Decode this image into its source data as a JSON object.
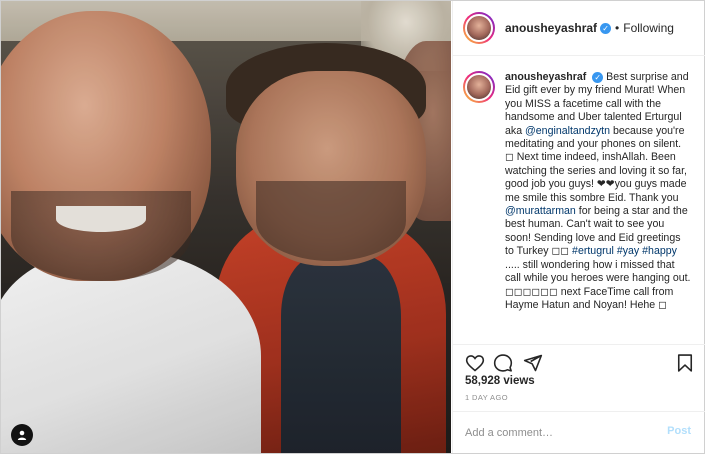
{
  "post": {
    "username": "anousheyashraf",
    "separator": "•",
    "follow_status": "Following"
  },
  "caption": {
    "username": "anousheyashraf",
    "segments": [
      {
        "text": "Best surprise and Eid gift ever by my friend Murat! When you MISS a facetime call with the handsome and Uber talented Erturgul aka ",
        "link": false
      },
      {
        "text": "@enginaltandzytn",
        "link": true
      },
      {
        "text": " because you're meditating and your phones on silent. ◻ Next time indeed, inshAllah. Been watching the series and loving it so far, good job you guys! ❤❤you guys made me smile this sombre Eid. Thank you ",
        "link": false
      },
      {
        "text": "@murattarman",
        "link": true
      },
      {
        "text": " for being a star and the best human. Can't wait to see you soon! Sending love and Eid greetings to Turkey ◻◻ ",
        "link": false
      },
      {
        "text": "#ertugrul",
        "link": true
      },
      {
        "text": " ",
        "link": false
      },
      {
        "text": "#yay",
        "link": true
      },
      {
        "text": " ",
        "link": false
      },
      {
        "text": "#happy",
        "link": true
      },
      {
        "text": " ..... still wondering how i missed that call while you heroes were hanging out. ◻◻◻◻◻◻ next FaceTime call from Hayme Hatun and Noyan! Hehe ◻",
        "link": false
      }
    ]
  },
  "stats": {
    "views": "58,928 views",
    "time_ago": "1 DAY AGO"
  },
  "comment_box": {
    "placeholder": "Add a comment…",
    "post_label": "Post"
  },
  "colors": {
    "verified": "#3897f0",
    "link": "#00376b",
    "post_disabled": "#b2dffc",
    "border": "#efefef"
  },
  "icons": {
    "like": "heart-icon",
    "comment": "comment-icon",
    "share": "share-icon",
    "save": "bookmark-icon",
    "tags": "user-tag-icon"
  }
}
